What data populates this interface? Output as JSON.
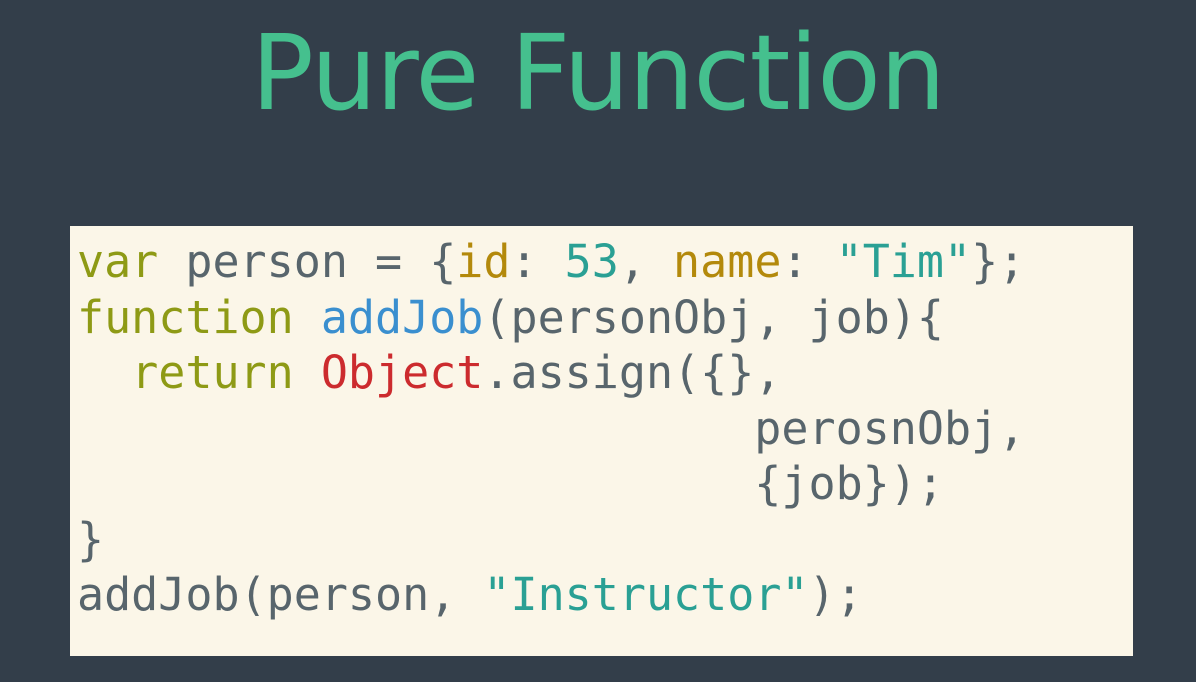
{
  "slide": {
    "title": "Pure Function"
  },
  "colors": {
    "background": "#333e4a",
    "title": "#45c08e",
    "code_panel": "#fbf6e8",
    "code_default": "#58656c",
    "keyword": "#8e9a15",
    "property": "#b3890b",
    "number_string": "#2aa094",
    "function_name": "#3a8fcf",
    "class_name": "#cc2b2e"
  },
  "code": {
    "lines": [
      [
        {
          "t": "var",
          "k": "kw"
        },
        {
          "t": " person = {",
          "k": "plain"
        },
        {
          "t": "id",
          "k": "prop"
        },
        {
          "t": ": ",
          "k": "plain"
        },
        {
          "t": "53",
          "k": "num"
        },
        {
          "t": ", ",
          "k": "plain"
        },
        {
          "t": "name",
          "k": "prop"
        },
        {
          "t": ": ",
          "k": "plain"
        },
        {
          "t": "\"Tim\"",
          "k": "str"
        },
        {
          "t": "};",
          "k": "plain"
        }
      ],
      [
        {
          "t": "function",
          "k": "kw"
        },
        {
          "t": " ",
          "k": "plain"
        },
        {
          "t": "addJob",
          "k": "fn"
        },
        {
          "t": "(personObj, job){",
          "k": "plain"
        }
      ],
      [
        {
          "t": "  ",
          "k": "plain"
        },
        {
          "t": "return",
          "k": "kw"
        },
        {
          "t": " ",
          "k": "plain"
        },
        {
          "t": "Object",
          "k": "cls"
        },
        {
          "t": ".assign({},",
          "k": "plain"
        }
      ],
      [
        {
          "t": "                         perosnObj,",
          "k": "plain"
        }
      ],
      [
        {
          "t": "                         {job});",
          "k": "plain"
        }
      ],
      [
        {
          "t": "}",
          "k": "plain"
        }
      ],
      [
        {
          "t": "addJob(person, ",
          "k": "plain"
        },
        {
          "t": "\"Instructor\"",
          "k": "str"
        },
        {
          "t": ");",
          "k": "plain"
        }
      ]
    ]
  }
}
